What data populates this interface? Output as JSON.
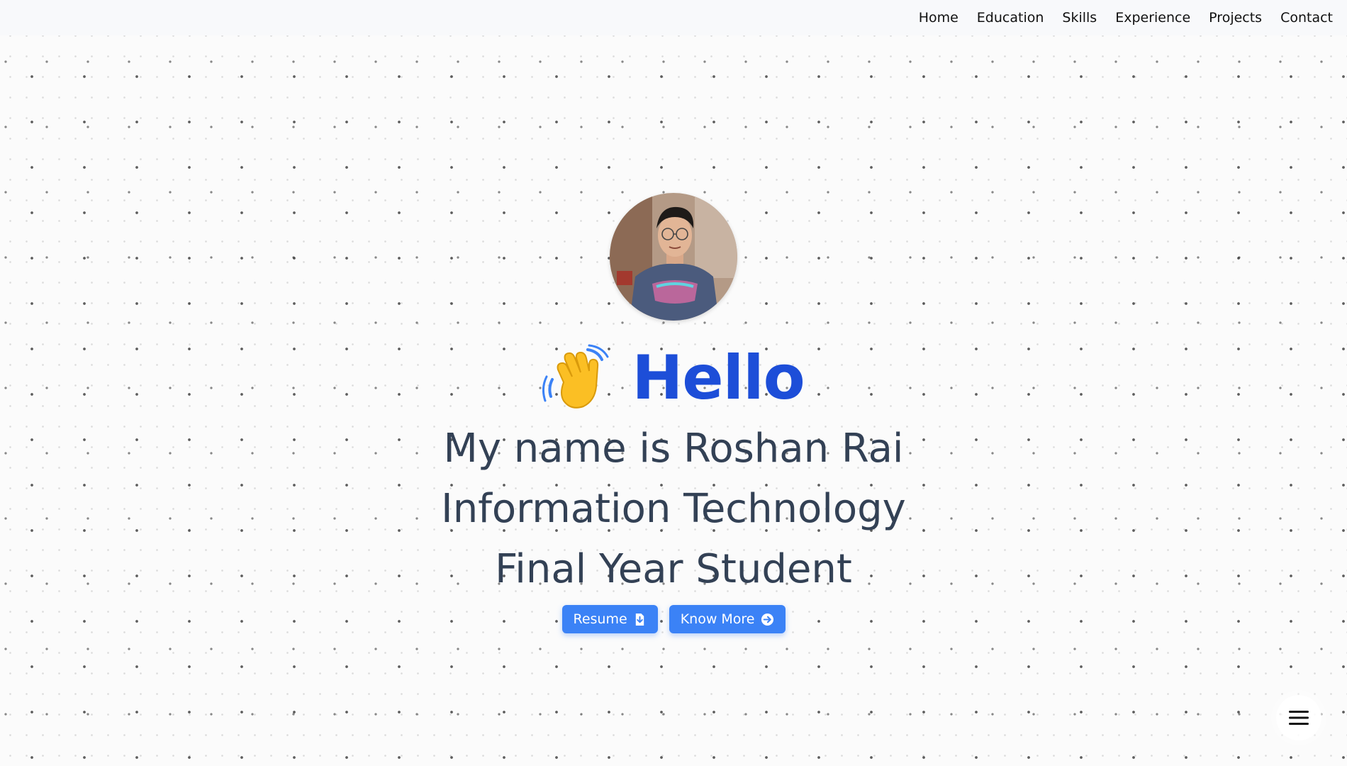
{
  "nav": {
    "items": [
      {
        "label": "Home"
      },
      {
        "label": "Education"
      },
      {
        "label": "Skills"
      },
      {
        "label": "Experience"
      },
      {
        "label": "Projects"
      },
      {
        "label": "Contact"
      }
    ]
  },
  "hero": {
    "greeting": "Hello",
    "line1": "My name is Roshan Rai",
    "line2": "Information Technology",
    "line3": "Final Year Student",
    "buttons": {
      "resume_label": "Resume",
      "know_more_label": "Know More"
    }
  },
  "icons": {
    "wave": "waving-hand-icon",
    "resume": "download-file-icon",
    "know_more": "arrow-circle-right-icon",
    "menu": "hamburger-menu-icon"
  },
  "colors": {
    "greeting": "#1d4ed8",
    "tagline": "#334155",
    "button": "#3b82f6",
    "nav_bg": "#f8f9fb"
  }
}
